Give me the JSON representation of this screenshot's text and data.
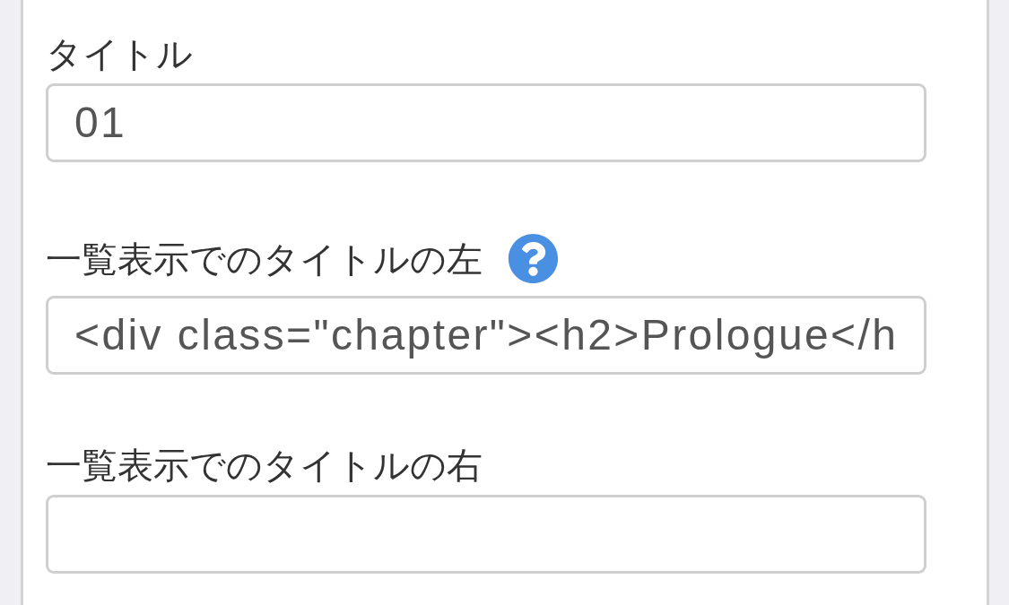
{
  "fields": [
    {
      "label": "タイトル",
      "help": false,
      "value": "01"
    },
    {
      "label": "一覧表示でのタイトルの左",
      "help": true,
      "value": "<div class=\"chapter\"><h2>Prologue</h"
    },
    {
      "label": "一覧表示でのタイトルの右",
      "help": false
    }
  ]
}
